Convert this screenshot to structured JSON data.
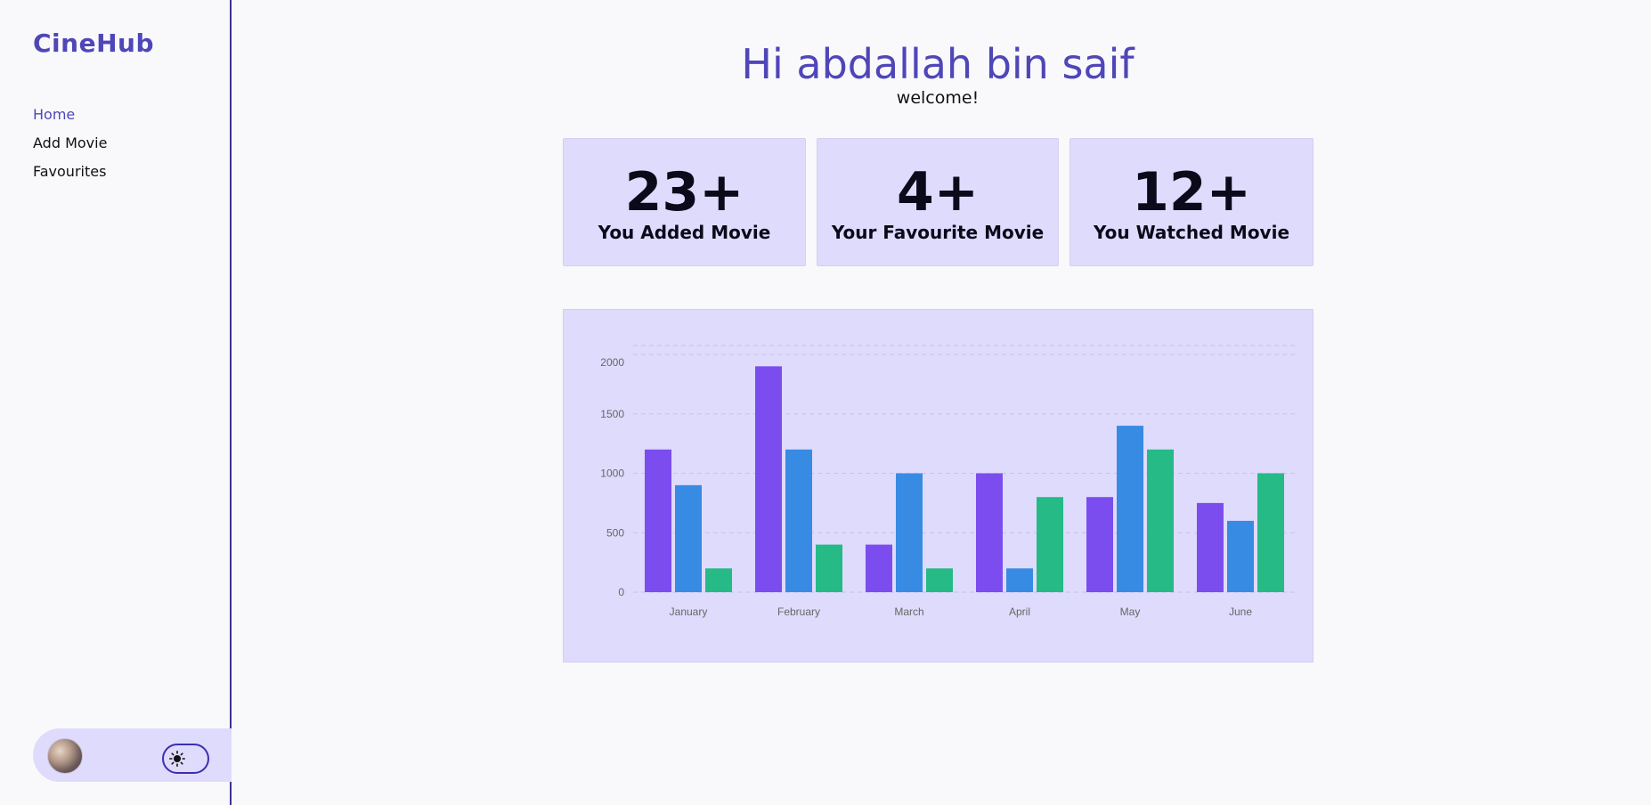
{
  "app": {
    "brand": "CineHub"
  },
  "sidebar": {
    "items": [
      {
        "label": "Home",
        "active": true
      },
      {
        "label": "Add Movie",
        "active": false
      },
      {
        "label": "Favourites",
        "active": false
      }
    ]
  },
  "header": {
    "greeting": "Hi abdallah bin saif",
    "welcome": "welcome!"
  },
  "stats": [
    {
      "value": "23+",
      "label": "You Added Movie"
    },
    {
      "value": "4+",
      "label": "Your Favourite Movie"
    },
    {
      "value": "12+",
      "label": "You Watched Movie"
    }
  ],
  "colors": {
    "accent": "#4f46b8",
    "card_bg": "#dfdbfc",
    "series": [
      "#7c4dee",
      "#388be3",
      "#25ba86"
    ]
  },
  "icons": {
    "theme_toggle": "sun-icon",
    "avatar": "user-avatar"
  },
  "chart_data": {
    "type": "bar",
    "categories": [
      "January",
      "February",
      "March",
      "April",
      "May",
      "June"
    ],
    "series": [
      {
        "values": [
          1200,
          1900,
          400,
          1000,
          800,
          750
        ]
      },
      {
        "values": [
          900,
          1200,
          1000,
          200,
          1400,
          600
        ]
      },
      {
        "values": [
          200,
          400,
          200,
          800,
          1200,
          1000
        ]
      }
    ],
    "yticks": [
      0,
      500,
      1000,
      1500,
      2000
    ],
    "ylim": [
      0,
      2000
    ],
    "grid": true,
    "legend": "none"
  }
}
